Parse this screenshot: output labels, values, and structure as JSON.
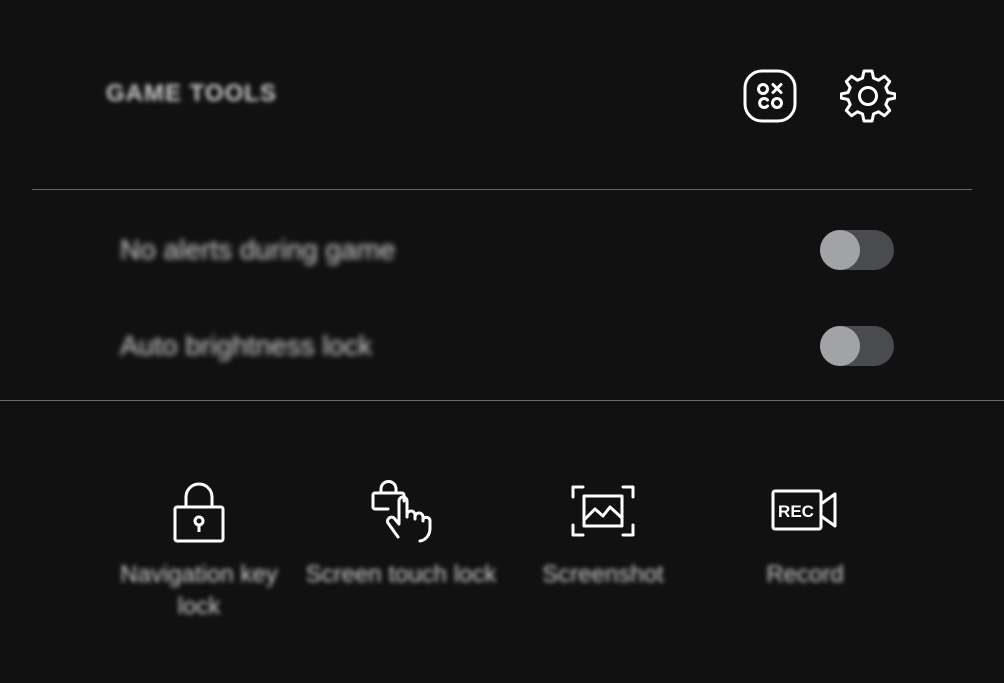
{
  "header": {
    "title": "GAME TOOLS",
    "icons": [
      "game-launcher-icon",
      "settings-gear-icon"
    ]
  },
  "toggles": [
    {
      "label": "No alerts during game",
      "on": false
    },
    {
      "label": "Auto brightness lock",
      "on": false
    }
  ],
  "tools": [
    {
      "label": "Navigation key lock",
      "icon": "padlock-icon"
    },
    {
      "label": "Screen touch lock",
      "icon": "touch-lock-icon"
    },
    {
      "label": "Screenshot",
      "icon": "screenshot-icon"
    },
    {
      "label": "Record",
      "icon": "record-icon",
      "icon_text": "REC"
    }
  ],
  "colors": {
    "background": "#111111",
    "divider": "#6a6a6a",
    "toggle_track": "#4a4b4f",
    "toggle_knob": "#a2a3a7",
    "icon": "#ffffff"
  }
}
